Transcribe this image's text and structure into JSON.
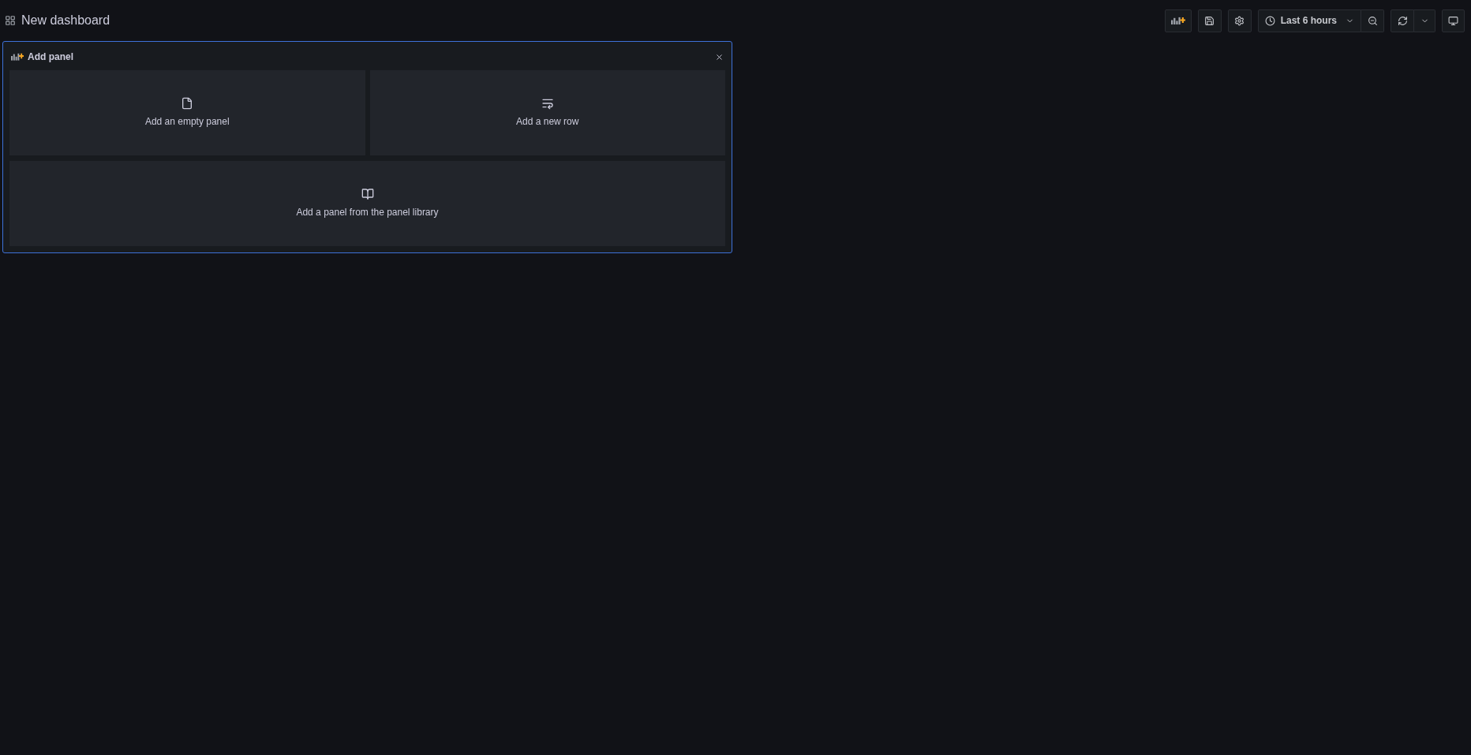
{
  "header": {
    "title": "New dashboard"
  },
  "toolbar": {
    "time_range": "Last 6 hours"
  },
  "add_panel": {
    "title": "Add panel",
    "options": [
      {
        "kind": "empty",
        "label": "Add an empty panel"
      },
      {
        "kind": "row",
        "label": "Add a new row"
      },
      {
        "kind": "library",
        "label": "Add a panel from the panel library"
      }
    ]
  }
}
